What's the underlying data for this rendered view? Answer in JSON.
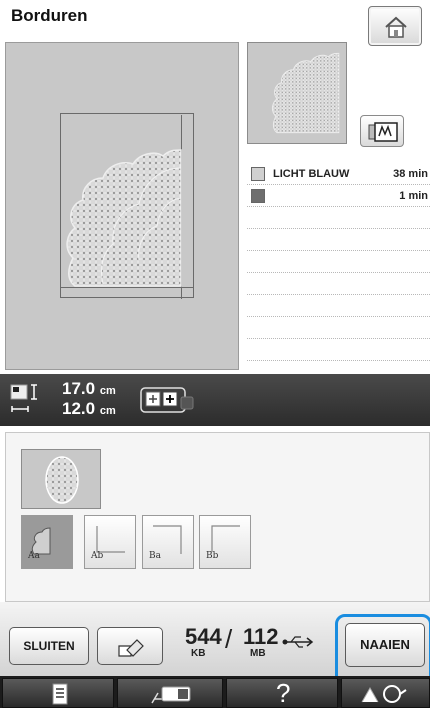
{
  "header": {
    "title": "Borduren"
  },
  "icons": {
    "home": "home-icon",
    "frame_display": "embroidery-frame-icon",
    "size": "size-arrows-icon",
    "fit_frame": "fit-frame-icon",
    "erase": "eraser-icon",
    "usb": "usb-icon",
    "document": "document-icon",
    "sewing_machine": "sewing-machine-icon",
    "help": "help-icon",
    "thread": "thread-icon"
  },
  "thread_colors": [
    {
      "name": "LICHT BLAUW",
      "time": "38 min",
      "swatch": "#d0d0d0"
    },
    {
      "name": "",
      "time": "1 min",
      "swatch": "#6e6e6e"
    }
  ],
  "size": {
    "height_value": "17.0",
    "height_unit": "cm",
    "width_value": "12.0",
    "width_unit": "cm"
  },
  "arrangement_labels": [
    "Aa",
    "Ab",
    "Ba",
    "Bb"
  ],
  "buttons": {
    "close": "SLUITEN",
    "sew": "NAAIEN"
  },
  "memory": {
    "used": "544",
    "used_unit": "KB",
    "separator": "/",
    "total": "112",
    "total_unit": "MB"
  },
  "navbar": {
    "help_glyph": "?"
  },
  "colors": {
    "highlight": "#1a8de0",
    "info_bar": "#2c2c2c",
    "preview_bg": "#c8c8c8"
  }
}
